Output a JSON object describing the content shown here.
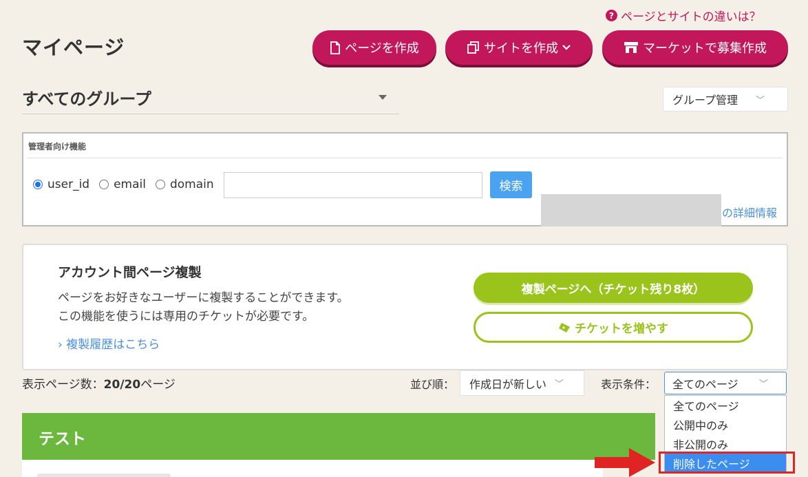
{
  "help": {
    "text": "ページとサイトの違いは？",
    "icon": "?"
  },
  "page_title": "マイページ",
  "actions": {
    "create_page": "ページを作成",
    "create_site": "サイトを作成",
    "market": "マーケットで募集作成"
  },
  "group": {
    "selected": "すべてのグループ",
    "manage": "グループ管理"
  },
  "admin": {
    "title": "管理者向け機能",
    "options": [
      "user_id",
      "email",
      "domain"
    ],
    "selected_option": "user_id",
    "search_value": "",
    "search_button": "検索",
    "detail_link": "の詳細情報"
  },
  "copy": {
    "title": "アカウント間ページ複製",
    "desc_line1": "ページをお好きなユーザーに複製することができます。",
    "desc_line2": "この機能を使うには専用のチケットが必要です。",
    "history_link": "› 複製履歴はこちら",
    "copy_button": "複製ページへ（チケット残り8枚）",
    "ticket_button": "チケットを増やす"
  },
  "list": {
    "count_label": "表示ページ数：",
    "count_value": "20/20",
    "count_unit": "ページ",
    "sort_label": "並び順：",
    "sort_value": "作成日が新しい",
    "filter_label": "表示条件：",
    "filter_value": "全てのページ",
    "filter_options": [
      "全てのページ",
      "公開中のみ",
      "非公開のみ",
      "削除したページ"
    ],
    "highlighted_option": "削除したページ"
  },
  "card": {
    "title": "テスト"
  },
  "colors": {
    "primary": "#c2185b",
    "accent_green": "#9ac31c",
    "card_green": "#6cb73d",
    "link": "#4a90d9",
    "highlight": "#e02424"
  }
}
